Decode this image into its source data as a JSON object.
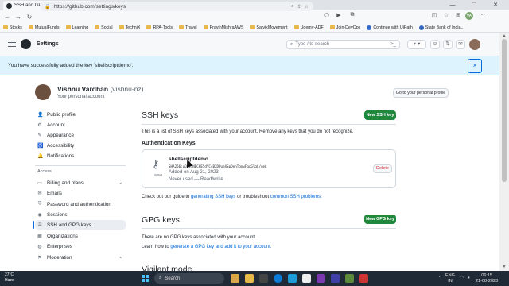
{
  "browser": {
    "tab_title": "SSH and GPG keys",
    "tab_close": "×",
    "new_tab": "+",
    "url": "https://github.com/settings/keys",
    "bookmarks": [
      "Stocks",
      "MutualFunds",
      "Learning",
      "Social",
      "TechniX",
      "RPA-Tools",
      "Travel",
      "PravinMishraAWS",
      "SatvikMovement",
      "Udemy-ADF",
      "Join-DevOps",
      "Continue with UiPath",
      "State Bank of India..."
    ],
    "profile_initials": "VA"
  },
  "header": {
    "title": "Settings",
    "search_placeholder": "Type / to search",
    "search_slash": "/",
    "search_cmd": ">_",
    "new_label": "+ ▾"
  },
  "flash": {
    "message": "You have successfully added the key 'shellscriptdemo'.",
    "close": "×"
  },
  "user": {
    "name": "Vishnu Vardhan",
    "login": "(vishnu-nz)",
    "subtitle": "Your personal account",
    "personal_button": "Go to your personal profile"
  },
  "sidebar": {
    "items": [
      {
        "label": "Public profile",
        "icon": "person-icon"
      },
      {
        "label": "Account",
        "icon": "gear-icon"
      },
      {
        "label": "Appearance",
        "icon": "paintbrush-icon"
      },
      {
        "label": "Accessibility",
        "icon": "accessibility-icon"
      },
      {
        "label": "Notifications",
        "icon": "bell-icon"
      }
    ],
    "access_heading": "Access",
    "access_items": [
      {
        "label": "Billing and plans",
        "icon": "credit-card-icon"
      },
      {
        "label": "Emails",
        "icon": "mail-icon"
      },
      {
        "label": "Password and authentication",
        "icon": "shield-lock-icon"
      },
      {
        "label": "Sessions",
        "icon": "broadcast-icon"
      },
      {
        "label": "SSH and GPG keys",
        "icon": "key-icon"
      },
      {
        "label": "Organizations",
        "icon": "organization-icon"
      },
      {
        "label": "Enterprises",
        "icon": "globe-icon"
      },
      {
        "label": "Moderation",
        "icon": "report-icon"
      }
    ]
  },
  "ssh": {
    "heading": "SSH keys",
    "new_button": "New SSH key",
    "description": "This is a list of SSH keys associated with your account. Remove any keys that you do not recognize.",
    "auth_heading": "Authentication Keys",
    "key": {
      "title": "shellscriptdemo",
      "fingerprint": "SHA256:uQ1C1NBCHE5dYCsB2DPueXSpDenTqnwFgcGlgC/qek",
      "added": "Added on Aug 21, 2023",
      "used": "Never used — Read/write",
      "type": "SSH",
      "delete_label": "Delete"
    },
    "guide_pre": "Check out our guide to",
    "guide_link1": "generating SSH keys",
    "guide_mid": "or troubleshoot",
    "guide_link2": "common SSH problems."
  },
  "gpg": {
    "heading": "GPG keys",
    "new_button": "New GPG key",
    "empty": "There are no GPG keys associated with your account.",
    "learn_pre": "Learn how to",
    "learn_link": "generate a GPG key and add it to your account."
  },
  "vigilant": {
    "heading": "Vigilant mode"
  },
  "taskbar": {
    "temp": "27°C",
    "weather": "Haze",
    "search": "Search",
    "lang": "ENG",
    "region": "IN",
    "time": "06:15",
    "date": "21-08-2023"
  }
}
